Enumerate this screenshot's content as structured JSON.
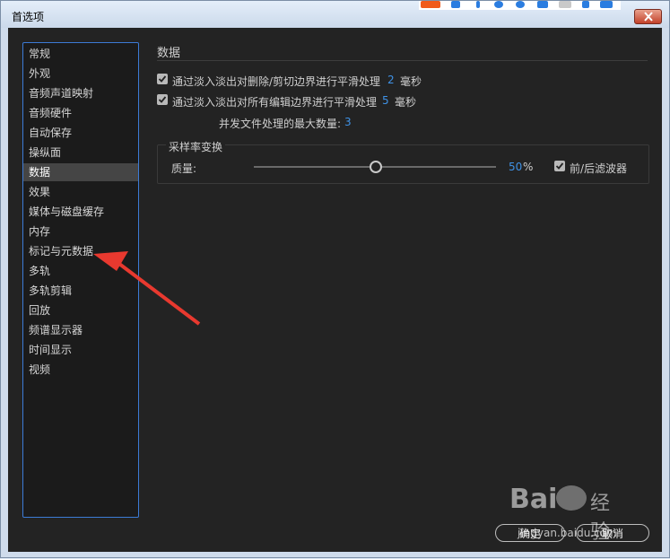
{
  "window": {
    "title": "首选项"
  },
  "sidebar": {
    "items": [
      {
        "label": "常规"
      },
      {
        "label": "外观"
      },
      {
        "label": "音频声道映射"
      },
      {
        "label": "音频硬件"
      },
      {
        "label": "自动保存"
      },
      {
        "label": "操纵面"
      },
      {
        "label": "数据",
        "active": true
      },
      {
        "label": "效果"
      },
      {
        "label": "媒体与磁盘缓存"
      },
      {
        "label": "内存"
      },
      {
        "label": "标记与元数据"
      },
      {
        "label": "多轨"
      },
      {
        "label": "多轨剪辑"
      },
      {
        "label": "回放"
      },
      {
        "label": "频谱显示器"
      },
      {
        "label": "时间显示"
      },
      {
        "label": "视频"
      }
    ]
  },
  "main": {
    "section_title": "数据",
    "option1": {
      "label": "通过淡入淡出对删除/剪切边界进行平滑处理",
      "value": "2",
      "unit": "毫秒",
      "checked": true
    },
    "option2": {
      "label": "通过淡入淡出对所有编辑边界进行平滑处理",
      "value": "5",
      "unit": "毫秒",
      "checked": true
    },
    "max_files": {
      "label": "并发文件处理的最大数量:",
      "value": "3"
    },
    "resample": {
      "legend": "采样率变换",
      "quality_label": "质量:",
      "quality_value": "50",
      "quality_unit": "%",
      "quality_fraction": 0.5,
      "filter_label": "前/后滤波器",
      "filter_checked": true
    }
  },
  "footer": {
    "ok_label": "确定",
    "cancel_label": "取消"
  },
  "watermark": {
    "brand": "Bai",
    "sub": "经验",
    "url": "jingyan.baidu.com"
  },
  "colors": {
    "accent": "#3f92e6",
    "arrow": "#e8392f"
  }
}
